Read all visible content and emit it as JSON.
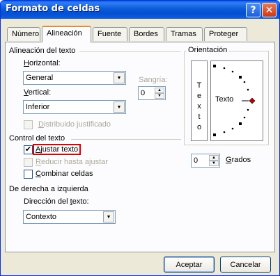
{
  "window": {
    "title": "Formato de celdas",
    "help_glyph": "?",
    "close_glyph": "✕"
  },
  "tabs": [
    {
      "label": "Número"
    },
    {
      "label": "Alineación"
    },
    {
      "label": "Fuente"
    },
    {
      "label": "Bordes"
    },
    {
      "label": "Tramas"
    },
    {
      "label": "Proteger"
    }
  ],
  "alignment": {
    "section_title": "Alineación del texto",
    "horizontal_label_u": "H",
    "horizontal_label_rest": "orizontal:",
    "horizontal_value": "General",
    "vertical_label_u": "V",
    "vertical_label_rest": "ertical:",
    "vertical_value": "Inferior",
    "indent_label": "Sangría:",
    "indent_value": "0",
    "distributed_label_u": "D",
    "distributed_label_rest": "istribuido justificado"
  },
  "text_control": {
    "section_title": "Control del texto",
    "wrap_u": "A",
    "wrap_rest": "justar texto",
    "wrap_checked": true,
    "shrink_u": "R",
    "shrink_rest": "educir hasta ajustar",
    "merge_u": "C",
    "merge_rest": "ombinar celdas"
  },
  "rtl": {
    "section_title": "De derecha a izquierda",
    "direction_label_pre": "Dirección del ",
    "direction_label_u": "t",
    "direction_label_post": "exto:",
    "direction_value": "Contexto"
  },
  "orientation": {
    "section_title": "Orientación",
    "vertical_text": [
      "T",
      "e",
      "x",
      "t",
      "o"
    ],
    "dial_text": "Texto",
    "degrees_value": "0",
    "degrees_label_u": "G",
    "degrees_label_rest": "rados"
  },
  "buttons": {
    "ok": "Aceptar",
    "cancel": "Cancelar"
  },
  "colors": {
    "title_bar": "#0a5ee8",
    "highlight_box": "#e00000",
    "dial_marker": "#c00000"
  }
}
